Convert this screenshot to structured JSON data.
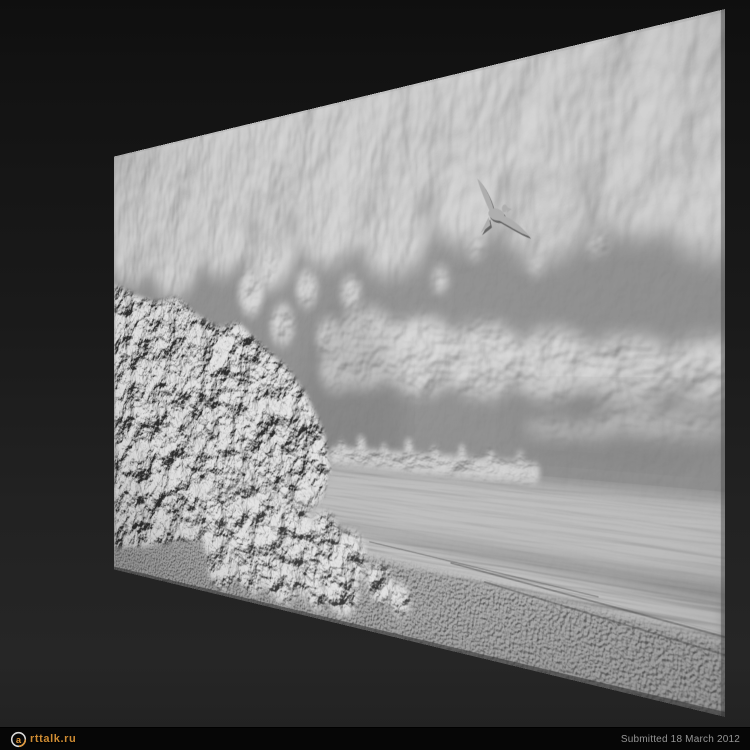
{
  "background": {
    "top": "#0f0f0f",
    "middle": "#1f1f1f",
    "bottom": "#242424"
  },
  "canvas": {
    "base_gray": "#7c7c7c",
    "highlight_gray": "#c4c4c4",
    "shadow_gray": "#2e2e2e",
    "elements": [
      "cloud-bank-top",
      "cloud-clumps",
      "middle-cloud-band",
      "seagull",
      "rock-cliff",
      "boulder-pile",
      "distant-shore",
      "sea-horizon",
      "pebble-beach"
    ]
  },
  "footer": {
    "bar_color": "#060606",
    "logo_mark": "a",
    "logo_rest": "rttalk.ru",
    "logo_color": "#cf8c33",
    "submitted_label": "Submitted 18 March 2012",
    "submitted_color": "#969696"
  }
}
